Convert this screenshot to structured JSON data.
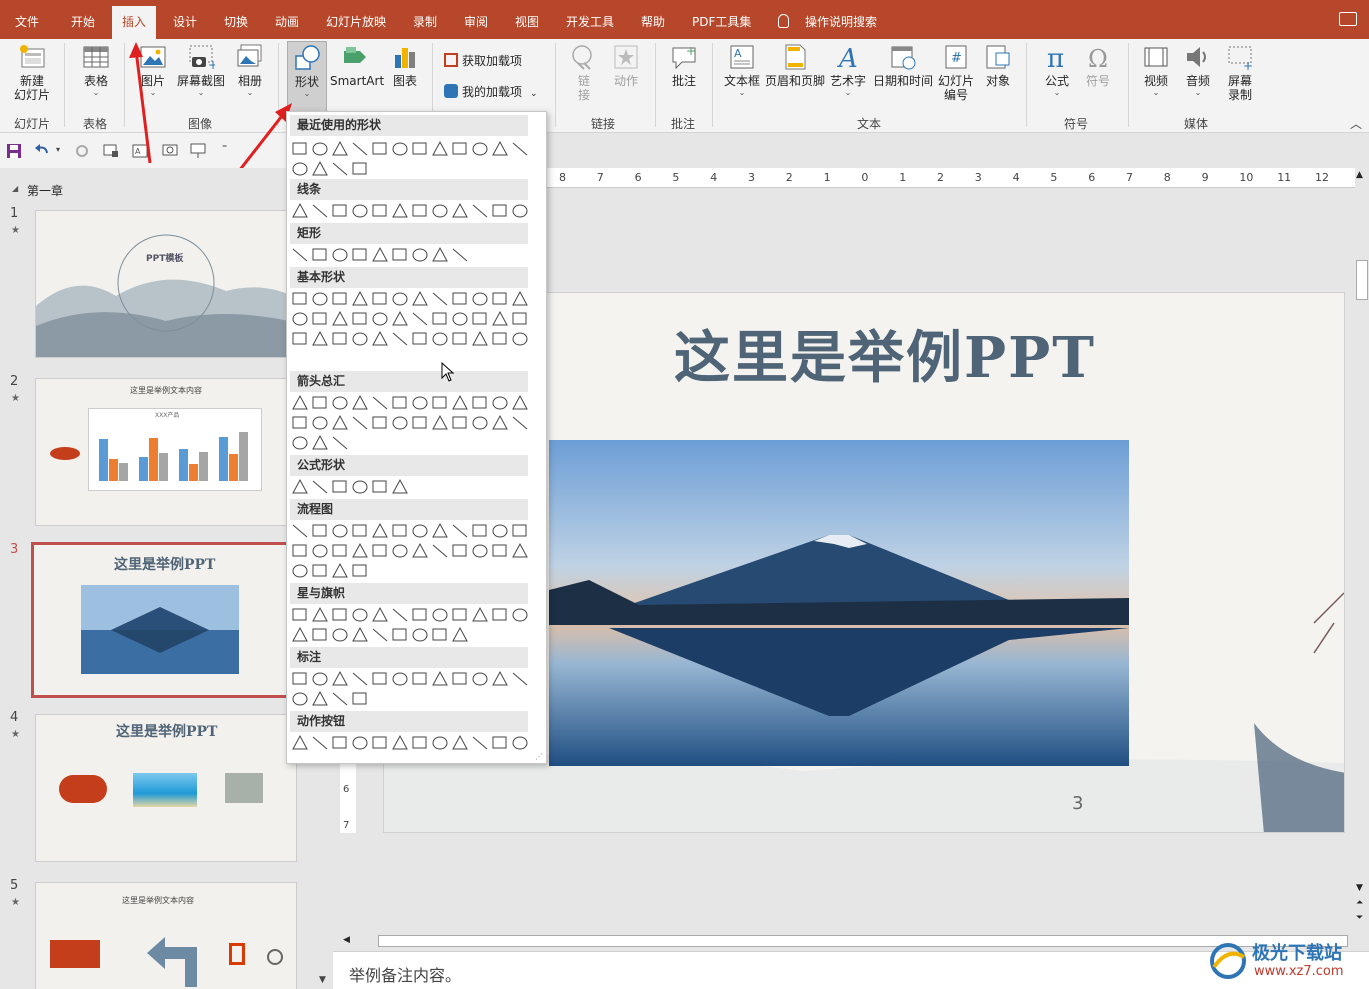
{
  "menubar": {
    "tabs": [
      "文件",
      "开始",
      "插入",
      "设计",
      "切换",
      "动画",
      "幻灯片放映",
      "录制",
      "审阅",
      "视图",
      "开发工具",
      "帮助",
      "PDF工具集"
    ],
    "active_tab": "插入",
    "search_label": "操作说明搜索"
  },
  "ribbon": {
    "new_slide": "新建\n幻灯片",
    "table": "表格",
    "picture": "图片",
    "screenshot": "屏幕截图",
    "album": "相册",
    "shapes": "形状",
    "smartart": "SmartArt",
    "chart": "图表",
    "get_addins": "获取加载项",
    "my_addins": "我的加载项",
    "link": "链接",
    "action": "动作",
    "comment": "批注",
    "textbox": "文本框",
    "header_footer": "页眉和页脚",
    "wordart": "艺术字",
    "datetime": "日期和时间",
    "slide_number": "幻灯片\n编号",
    "object": "对象",
    "equation": "公式",
    "symbol": "符号",
    "video": "视频",
    "audio": "音频",
    "screen_record": "屏幕\n录制",
    "groups": {
      "slides": "幻灯片",
      "tables": "表格",
      "images": "图像",
      "links": "链接",
      "comments": "批注",
      "text": "文本",
      "symbols": "符号",
      "media": "媒体"
    }
  },
  "shapes_menu": {
    "categories": [
      "最近使用的形状",
      "线条",
      "矩形",
      "基本形状",
      "箭头总汇",
      "公式形状",
      "流程图",
      "星与旗帜",
      "标注",
      "动作按钮"
    ]
  },
  "slides_panel": {
    "section": "第一章",
    "slides": [
      {
        "num": "1",
        "title": "PPT模板"
      },
      {
        "num": "2",
        "title": "这里是举例文本内容",
        "chart_title": "XXX产品"
      },
      {
        "num": "3",
        "title": "这里是举例PPT",
        "selected": true
      },
      {
        "num": "4",
        "title": "这里是举例PPT"
      },
      {
        "num": "5",
        "title": "这里是举例文本内容"
      }
    ]
  },
  "ruler": {
    "marks": [
      "8",
      "7",
      "6",
      "5",
      "4",
      "3",
      "2",
      "1",
      "0",
      "1",
      "2",
      "3",
      "4",
      "5",
      "6",
      "7",
      "8",
      "9",
      "10",
      "11",
      "12"
    ],
    "left_marks": [
      "6",
      "7"
    ]
  },
  "slide": {
    "title": "这里是举例PPT",
    "page_number": "3"
  },
  "notes": {
    "text": "举例备注内容。"
  },
  "watermark": {
    "name": "极光下载站",
    "url": "www.xz7.com"
  }
}
